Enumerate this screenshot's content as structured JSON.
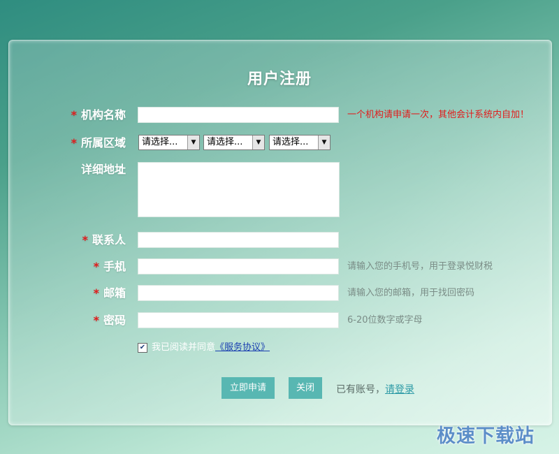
{
  "form": {
    "title": "用户注册",
    "required_mark": "*",
    "colon": "：",
    "fields": {
      "org_name": {
        "label": "机构名称",
        "value": "",
        "hint": "一个机构请申请一次，其他会计系统内自加！"
      },
      "region": {
        "label": "所属区域",
        "selects": [
          "请选择...",
          "请选择...",
          "请选择..."
        ]
      },
      "address": {
        "label": "详细地址",
        "value": ""
      },
      "contact": {
        "label": "联系人",
        "value": ""
      },
      "phone": {
        "label": "手机",
        "value": "",
        "hint": "请输入您的手机号，用于登录悦财税"
      },
      "email": {
        "label": "邮箱",
        "value": "",
        "hint": "请输入您的邮箱，用于找回密码"
      },
      "password": {
        "label": "密码",
        "value": "",
        "hint": "6-20位数字或字母"
      }
    },
    "agreement": {
      "text": "我已阅读并同意",
      "link": "《服务协议》",
      "checked": true
    },
    "buttons": {
      "submit": "立即申请",
      "close": "关闭"
    },
    "login": {
      "prompt": "已有账号，",
      "link": "请登录"
    }
  },
  "watermark": "极速下载站",
  "colors": {
    "required": "#e21b1b",
    "button": "#58b7b2",
    "link": "#1a3fb0",
    "login_link": "#2c9aa6"
  }
}
